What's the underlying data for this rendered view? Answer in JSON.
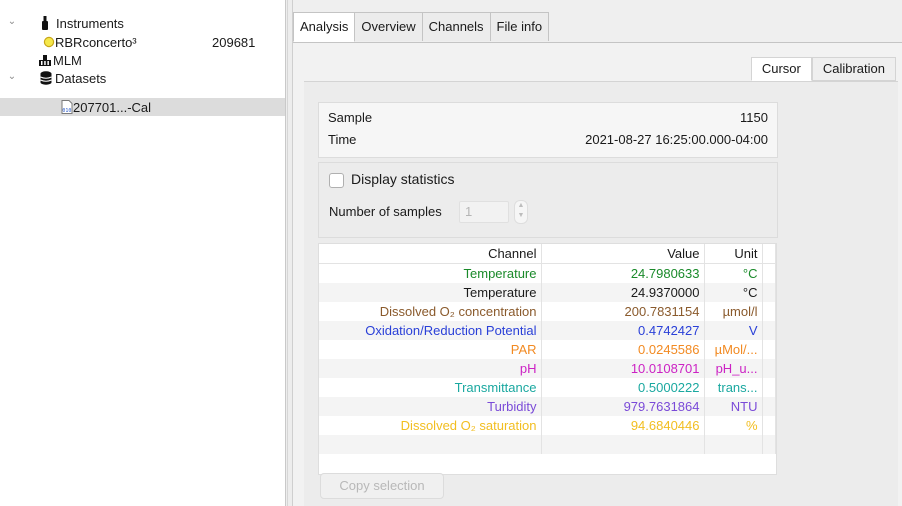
{
  "tree": {
    "items": [
      {
        "label": "Instruments",
        "icon": "instrument-icon",
        "expanded": true
      },
      {
        "label": "RBRconcerto³",
        "aux": "209681",
        "icon": "yellow-circle-icon",
        "icon_color": "#f5e84a"
      },
      {
        "label": "MLM",
        "icon": "mlm-icon"
      },
      {
        "label": "Datasets",
        "icon": "database-icon",
        "expanded": true
      },
      {
        "label": "207701...-Cal",
        "icon": "binary-file-icon",
        "selected": true
      }
    ]
  },
  "tabs": [
    {
      "label": "Analysis",
      "active": true
    },
    {
      "label": "Overview"
    },
    {
      "label": "Channels"
    },
    {
      "label": "File info"
    }
  ],
  "subtabs": [
    {
      "label": "Cursor",
      "active": true
    },
    {
      "label": "Calibration"
    }
  ],
  "info": {
    "sample_label": "Sample",
    "sample_value": "1150",
    "time_label": "Time",
    "time_value": "2021-08-27 16:25:00.000-04:00"
  },
  "stats": {
    "display_statistics_label": "Display statistics",
    "display_statistics_checked": false,
    "num_samples_label": "Number of samples",
    "num_samples_value": "1"
  },
  "table": {
    "headers": [
      "Channel",
      "Value",
      "Unit"
    ],
    "rows": [
      {
        "channel": "Temperature",
        "value": "24.7980633",
        "unit": "°C",
        "color": "#1a8a2a"
      },
      {
        "channel": "Temperature",
        "value": "24.9370000",
        "unit": "°C",
        "color": "#1a1a1a"
      },
      {
        "channel": "Dissolved O₂ concentration",
        "value": "200.7831154",
        "unit": "µmol/l",
        "color": "#8a5a2c"
      },
      {
        "channel": "Oxidation/Reduction Potential",
        "value": "0.4742427",
        "unit": "V",
        "color": "#2a40d8"
      },
      {
        "channel": "PAR",
        "value": "0.0245586",
        "unit": "µMol/...",
        "color": "#f28a22"
      },
      {
        "channel": "pH",
        "value": "10.0108701",
        "unit": "pH_u...",
        "color": "#cc22c4"
      },
      {
        "channel": "Transmittance",
        "value": "0.5000222",
        "unit": "trans...",
        "color": "#1aa8a0"
      },
      {
        "channel": "Turbidity",
        "value": "979.7631864",
        "unit": "NTU",
        "color": "#7a4ad8"
      },
      {
        "channel": "Dissolved O₂ saturation",
        "value": "94.6840446",
        "unit": "%",
        "color": "#f2be20"
      }
    ]
  },
  "copy_button_label": "Copy selection"
}
